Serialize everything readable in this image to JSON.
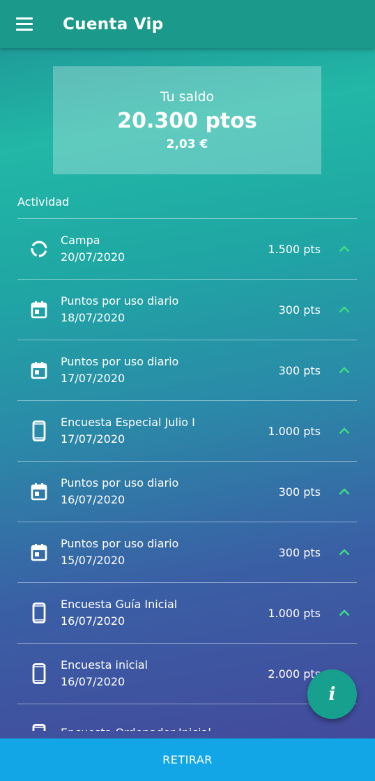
{
  "header": {
    "title": "Cuenta Vip",
    "menu_icon": "hamburger-menu-icon"
  },
  "balance": {
    "label": "Tu saldo",
    "points": "20.300 ptos",
    "euros": "2,03 €"
  },
  "activity": {
    "label": "Actividad",
    "items": [
      {
        "icon": "progress-icon",
        "title": "Campa",
        "date": "20/07/2020",
        "points": "1.500 pts",
        "chevron": true
      },
      {
        "icon": "calendar-icon",
        "title": "Puntos por uso diario",
        "date": "18/07/2020",
        "points": "300 pts",
        "chevron": true
      },
      {
        "icon": "calendar-icon",
        "title": "Puntos por uso diario",
        "date": "17/07/2020",
        "points": "300 pts",
        "chevron": true
      },
      {
        "icon": "phone-icon",
        "title": "Encuesta Especial Julio I",
        "date": "17/07/2020",
        "points": "1.000 pts",
        "chevron": true
      },
      {
        "icon": "calendar-icon",
        "title": "Puntos por uso diario",
        "date": "16/07/2020",
        "points": "300 pts",
        "chevron": true
      },
      {
        "icon": "calendar-icon",
        "title": "Puntos por uso diario",
        "date": "15/07/2020",
        "points": "300 pts",
        "chevron": true
      },
      {
        "icon": "phone-icon",
        "title": "Encuesta Guía Inicial",
        "date": "16/07/2020",
        "points": "1.000 pts",
        "chevron": true
      },
      {
        "icon": "phone-icon",
        "title": "Encuesta inicial",
        "date": "16/07/2020",
        "points": "2.000 pts",
        "chevron": false
      },
      {
        "icon": "phone-icon",
        "title": "Encuesta Ordenador Inicial",
        "date": "",
        "points": "",
        "chevron": false
      }
    ]
  },
  "fab": {
    "label": "i"
  },
  "footer": {
    "button": "RETIRAR"
  },
  "colors": {
    "appbar": "#1b9a8b",
    "chevron": "#3ddc84",
    "retirar": "#12a6e6",
    "fab": "#17a08d"
  }
}
